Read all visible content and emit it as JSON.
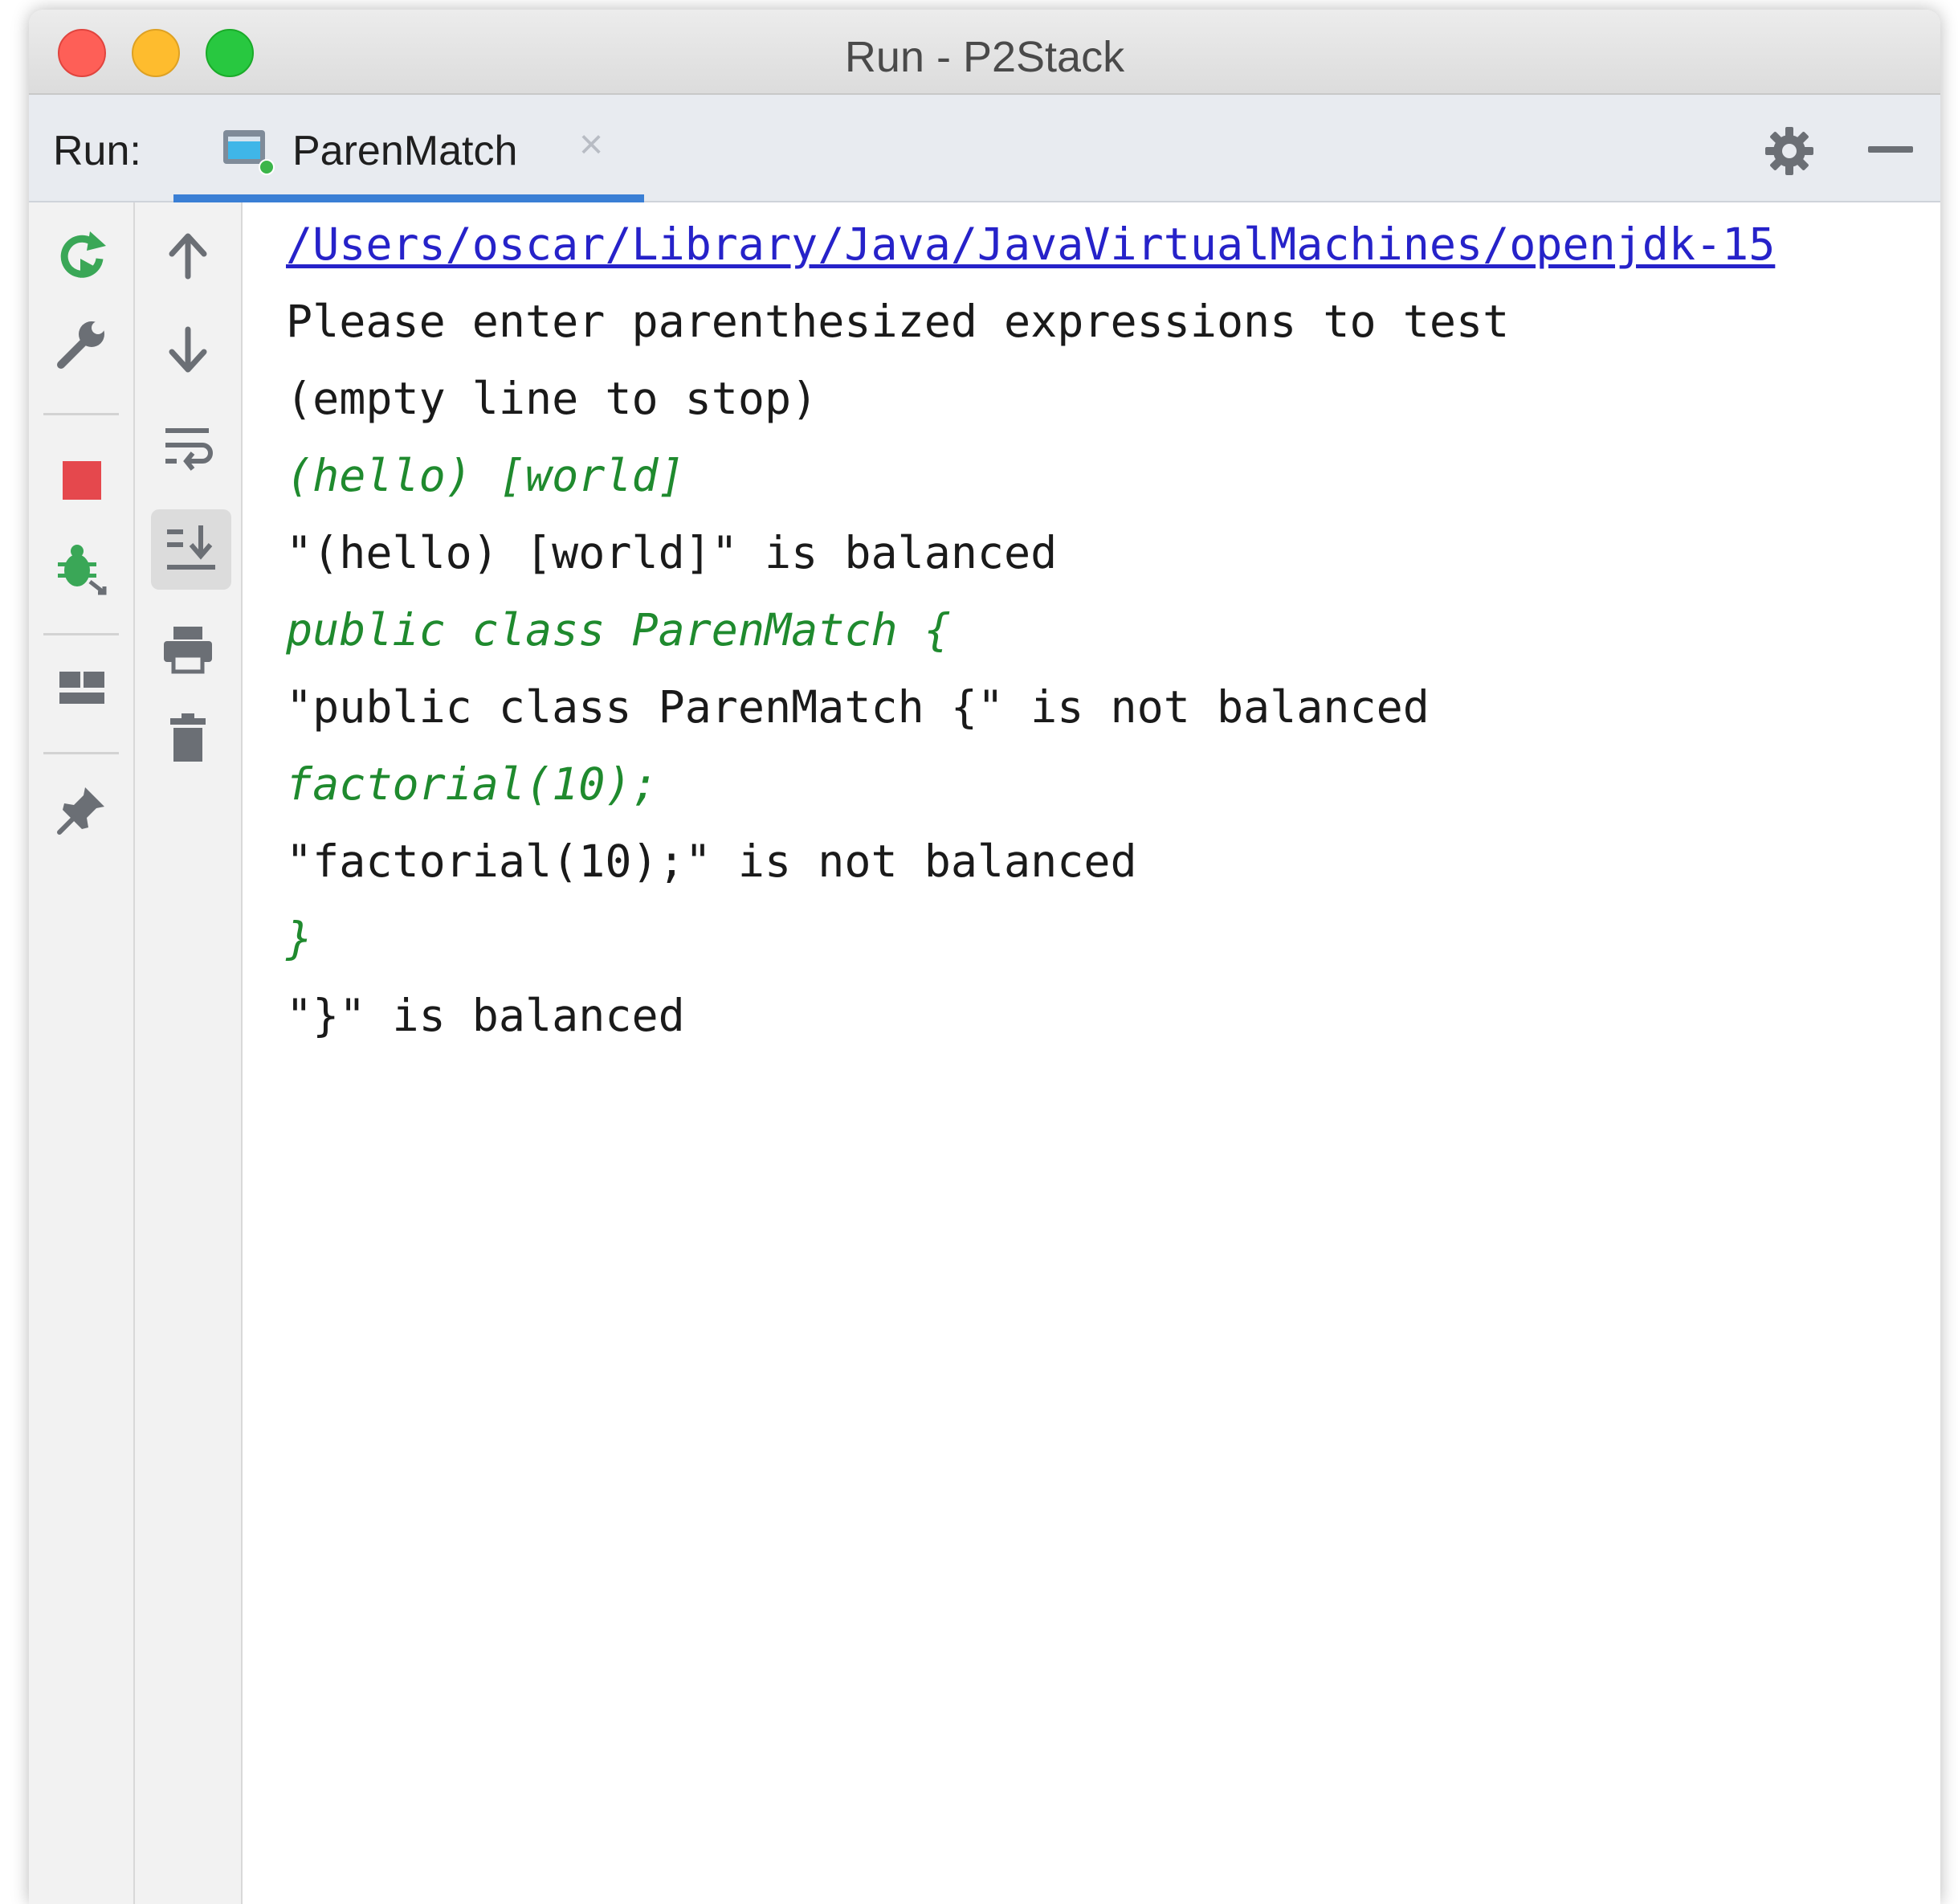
{
  "window": {
    "title": "Run - P2Stack"
  },
  "tabbar": {
    "run_label": "Run:",
    "tab_label": "ParenMatch",
    "tab_close": "×"
  },
  "toolbar_left": {
    "items": [
      "rerun-icon",
      "wrench-icon",
      "stop-icon",
      "debug-icon",
      "layout-icon",
      "pin-icon"
    ]
  },
  "toolbar_right": {
    "items": [
      "up-arrow-icon",
      "down-arrow-icon",
      "soft-wrap-icon",
      "scroll-to-end-icon",
      "print-icon",
      "trash-icon"
    ]
  },
  "console": {
    "lines": [
      {
        "type": "path",
        "text": "/Users/oscar/Library/Java/JavaVirtualMachines/openjdk-15"
      },
      {
        "type": "out",
        "text": "Please enter parenthesized expressions to test"
      },
      {
        "type": "out",
        "text": "(empty line to stop)"
      },
      {
        "type": "input",
        "text": "(hello) [world]"
      },
      {
        "type": "out",
        "text": "\"(hello) [world]\" is balanced"
      },
      {
        "type": "input",
        "text": "public class ParenMatch {"
      },
      {
        "type": "out",
        "text": "\"public class ParenMatch {\" is not balanced"
      },
      {
        "type": "input",
        "text": "factorial(10);"
      },
      {
        "type": "out",
        "text": "\"factorial(10);\" is not balanced"
      },
      {
        "type": "input",
        "text": "}"
      },
      {
        "type": "out",
        "text": "\"}\" is balanced"
      }
    ]
  },
  "colors": {
    "path_link": "#2622c9",
    "user_input": "#1f8a2e",
    "tab_underline": "#3a7fd5",
    "stop_red": "#e5484d",
    "run_green": "#3aa757"
  }
}
